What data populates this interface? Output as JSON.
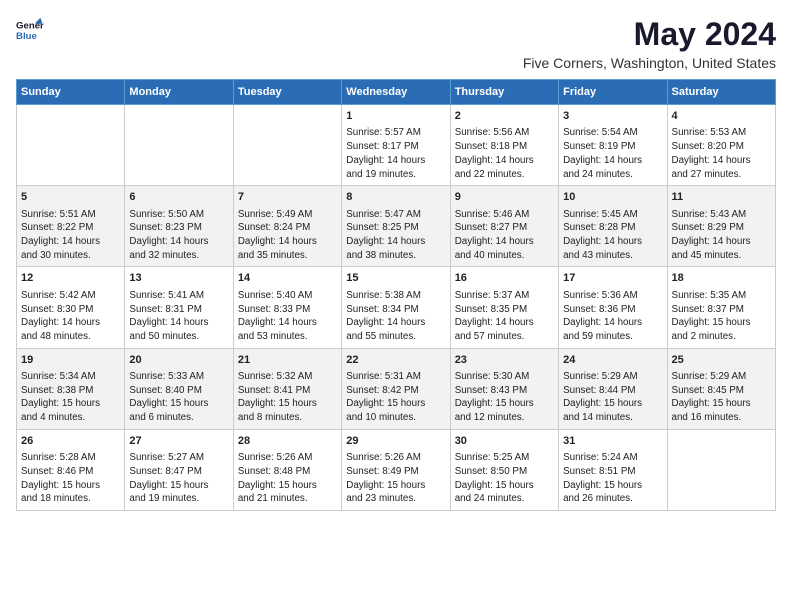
{
  "header": {
    "logo_line1": "General",
    "logo_line2": "Blue",
    "title": "May 2024",
    "subtitle": "Five Corners, Washington, United States"
  },
  "days_of_week": [
    "Sunday",
    "Monday",
    "Tuesday",
    "Wednesday",
    "Thursday",
    "Friday",
    "Saturday"
  ],
  "weeks": [
    [
      {
        "num": "",
        "info": ""
      },
      {
        "num": "",
        "info": ""
      },
      {
        "num": "",
        "info": ""
      },
      {
        "num": "1",
        "info": "Sunrise: 5:57 AM\nSunset: 8:17 PM\nDaylight: 14 hours\nand 19 minutes."
      },
      {
        "num": "2",
        "info": "Sunrise: 5:56 AM\nSunset: 8:18 PM\nDaylight: 14 hours\nand 22 minutes."
      },
      {
        "num": "3",
        "info": "Sunrise: 5:54 AM\nSunset: 8:19 PM\nDaylight: 14 hours\nand 24 minutes."
      },
      {
        "num": "4",
        "info": "Sunrise: 5:53 AM\nSunset: 8:20 PM\nDaylight: 14 hours\nand 27 minutes."
      }
    ],
    [
      {
        "num": "5",
        "info": "Sunrise: 5:51 AM\nSunset: 8:22 PM\nDaylight: 14 hours\nand 30 minutes."
      },
      {
        "num": "6",
        "info": "Sunrise: 5:50 AM\nSunset: 8:23 PM\nDaylight: 14 hours\nand 32 minutes."
      },
      {
        "num": "7",
        "info": "Sunrise: 5:49 AM\nSunset: 8:24 PM\nDaylight: 14 hours\nand 35 minutes."
      },
      {
        "num": "8",
        "info": "Sunrise: 5:47 AM\nSunset: 8:25 PM\nDaylight: 14 hours\nand 38 minutes."
      },
      {
        "num": "9",
        "info": "Sunrise: 5:46 AM\nSunset: 8:27 PM\nDaylight: 14 hours\nand 40 minutes."
      },
      {
        "num": "10",
        "info": "Sunrise: 5:45 AM\nSunset: 8:28 PM\nDaylight: 14 hours\nand 43 minutes."
      },
      {
        "num": "11",
        "info": "Sunrise: 5:43 AM\nSunset: 8:29 PM\nDaylight: 14 hours\nand 45 minutes."
      }
    ],
    [
      {
        "num": "12",
        "info": "Sunrise: 5:42 AM\nSunset: 8:30 PM\nDaylight: 14 hours\nand 48 minutes."
      },
      {
        "num": "13",
        "info": "Sunrise: 5:41 AM\nSunset: 8:31 PM\nDaylight: 14 hours\nand 50 minutes."
      },
      {
        "num": "14",
        "info": "Sunrise: 5:40 AM\nSunset: 8:33 PM\nDaylight: 14 hours\nand 53 minutes."
      },
      {
        "num": "15",
        "info": "Sunrise: 5:38 AM\nSunset: 8:34 PM\nDaylight: 14 hours\nand 55 minutes."
      },
      {
        "num": "16",
        "info": "Sunrise: 5:37 AM\nSunset: 8:35 PM\nDaylight: 14 hours\nand 57 minutes."
      },
      {
        "num": "17",
        "info": "Sunrise: 5:36 AM\nSunset: 8:36 PM\nDaylight: 14 hours\nand 59 minutes."
      },
      {
        "num": "18",
        "info": "Sunrise: 5:35 AM\nSunset: 8:37 PM\nDaylight: 15 hours\nand 2 minutes."
      }
    ],
    [
      {
        "num": "19",
        "info": "Sunrise: 5:34 AM\nSunset: 8:38 PM\nDaylight: 15 hours\nand 4 minutes."
      },
      {
        "num": "20",
        "info": "Sunrise: 5:33 AM\nSunset: 8:40 PM\nDaylight: 15 hours\nand 6 minutes."
      },
      {
        "num": "21",
        "info": "Sunrise: 5:32 AM\nSunset: 8:41 PM\nDaylight: 15 hours\nand 8 minutes."
      },
      {
        "num": "22",
        "info": "Sunrise: 5:31 AM\nSunset: 8:42 PM\nDaylight: 15 hours\nand 10 minutes."
      },
      {
        "num": "23",
        "info": "Sunrise: 5:30 AM\nSunset: 8:43 PM\nDaylight: 15 hours\nand 12 minutes."
      },
      {
        "num": "24",
        "info": "Sunrise: 5:29 AM\nSunset: 8:44 PM\nDaylight: 15 hours\nand 14 minutes."
      },
      {
        "num": "25",
        "info": "Sunrise: 5:29 AM\nSunset: 8:45 PM\nDaylight: 15 hours\nand 16 minutes."
      }
    ],
    [
      {
        "num": "26",
        "info": "Sunrise: 5:28 AM\nSunset: 8:46 PM\nDaylight: 15 hours\nand 18 minutes."
      },
      {
        "num": "27",
        "info": "Sunrise: 5:27 AM\nSunset: 8:47 PM\nDaylight: 15 hours\nand 19 minutes."
      },
      {
        "num": "28",
        "info": "Sunrise: 5:26 AM\nSunset: 8:48 PM\nDaylight: 15 hours\nand 21 minutes."
      },
      {
        "num": "29",
        "info": "Sunrise: 5:26 AM\nSunset: 8:49 PM\nDaylight: 15 hours\nand 23 minutes."
      },
      {
        "num": "30",
        "info": "Sunrise: 5:25 AM\nSunset: 8:50 PM\nDaylight: 15 hours\nand 24 minutes."
      },
      {
        "num": "31",
        "info": "Sunrise: 5:24 AM\nSunset: 8:51 PM\nDaylight: 15 hours\nand 26 minutes."
      },
      {
        "num": "",
        "info": ""
      }
    ]
  ]
}
